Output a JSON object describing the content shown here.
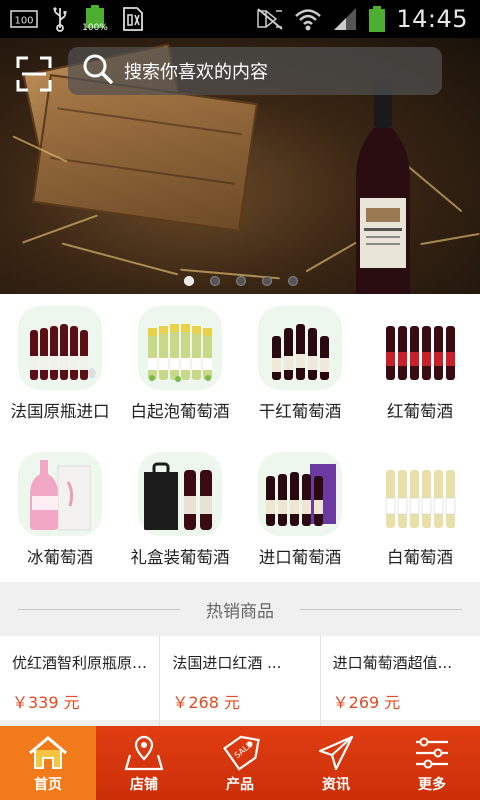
{
  "status_bar": {
    "time": "14:45",
    "battery_percent": "100%",
    "icons": [
      "screen-icon",
      "usb-icon",
      "battery-icon",
      "sim-icon",
      "mute-icon",
      "wifi-icon",
      "signal-icon",
      "battery-full-icon"
    ]
  },
  "search": {
    "placeholder": "搜索你喜欢的内容",
    "scan_icon": "scan-icon",
    "search_icon": "search-icon"
  },
  "banner": {
    "dots_total": 5,
    "active_dot": 0
  },
  "categories": [
    {
      "label": "法国原瓶进口",
      "icon": "red-wine-bottles-icon"
    },
    {
      "label": "白起泡葡萄酒",
      "icon": "sparkling-white-wine-icon"
    },
    {
      "label": "干红葡萄酒",
      "icon": "dry-red-wine-icon"
    },
    {
      "label": "红葡萄酒",
      "icon": "red-wine-icon"
    },
    {
      "label": "冰葡萄酒",
      "icon": "ice-wine-icon"
    },
    {
      "label": "礼盒装葡萄酒",
      "icon": "gift-box-wine-icon"
    },
    {
      "label": "进口葡萄酒",
      "icon": "imported-wine-icon"
    },
    {
      "label": "白葡萄酒",
      "icon": "white-wine-icon"
    }
  ],
  "hot": {
    "title": "热销商品",
    "products": [
      {
        "name": "优红酒智利原瓶原装...",
        "price": "￥339 元"
      },
      {
        "name": "法国进口红酒 ...",
        "price": "￥268 元"
      },
      {
        "name": "进口葡萄酒超值...",
        "price": "￥269 元"
      }
    ]
  },
  "tabbar": {
    "items": [
      {
        "label": "首页",
        "icon": "home-icon",
        "active": true
      },
      {
        "label": "店铺",
        "icon": "store-map-icon",
        "active": false
      },
      {
        "label": "产品",
        "icon": "sale-tag-icon",
        "active": false
      },
      {
        "label": "资讯",
        "icon": "paper-plane-icon",
        "active": false
      },
      {
        "label": "更多",
        "icon": "sliders-icon",
        "active": false
      }
    ]
  },
  "colors": {
    "accent_red": "#d8370c",
    "active_tab": "#f17a1a",
    "price": "#e4491f"
  }
}
